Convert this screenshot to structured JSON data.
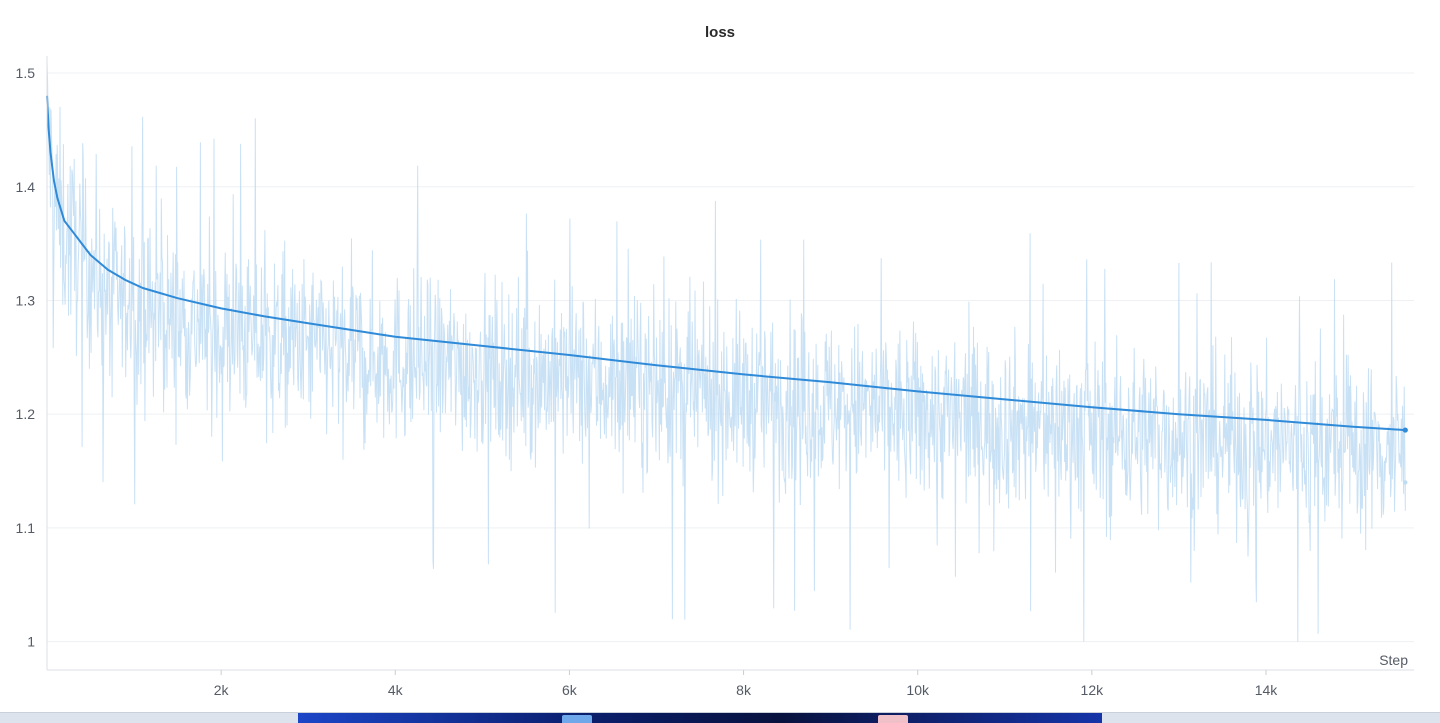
{
  "chart_data": {
    "type": "line",
    "title": "loss",
    "xlabel": "Step",
    "ylabel": "",
    "xlim": [
      0,
      15700
    ],
    "ylim": [
      0.975,
      1.515
    ],
    "x_ticks": [
      2000,
      4000,
      6000,
      8000,
      10000,
      12000,
      14000
    ],
    "x_tick_labels": [
      "2k",
      "4k",
      "6k",
      "8k",
      "10k",
      "12k",
      "14k"
    ],
    "y_ticks": [
      1.0,
      1.1,
      1.2,
      1.3,
      1.4,
      1.5
    ],
    "y_tick_labels": [
      "1",
      "1.1",
      "1.2",
      "1.3",
      "1.4",
      "1.5"
    ],
    "grid": true,
    "series": [
      {
        "role": "smoothed",
        "color": "#2f8ad8",
        "x": [
          0,
          20,
          40,
          80,
          120,
          200,
          300,
          400,
          500,
          700,
          900,
          1100,
          1500,
          2000,
          2500,
          3000,
          3500,
          4000,
          5000,
          6000,
          7000,
          8000,
          9000,
          10000,
          11000,
          12000,
          13000,
          14000,
          15000,
          15600
        ],
        "y": [
          1.48,
          1.45,
          1.43,
          1.405,
          1.39,
          1.37,
          1.36,
          1.35,
          1.34,
          1.327,
          1.318,
          1.311,
          1.302,
          1.293,
          1.286,
          1.28,
          1.274,
          1.268,
          1.26,
          1.252,
          1.243,
          1.235,
          1.228,
          1.22,
          1.213,
          1.206,
          1.2,
          1.195,
          1.189,
          1.186
        ]
      },
      {
        "role": "raw",
        "color": "#bfdcf3",
        "mean_offset": -0.02,
        "spread": 0.08,
        "min": 1.0,
        "max": 1.51,
        "last_point": [
          15600,
          1.14
        ]
      }
    ]
  }
}
